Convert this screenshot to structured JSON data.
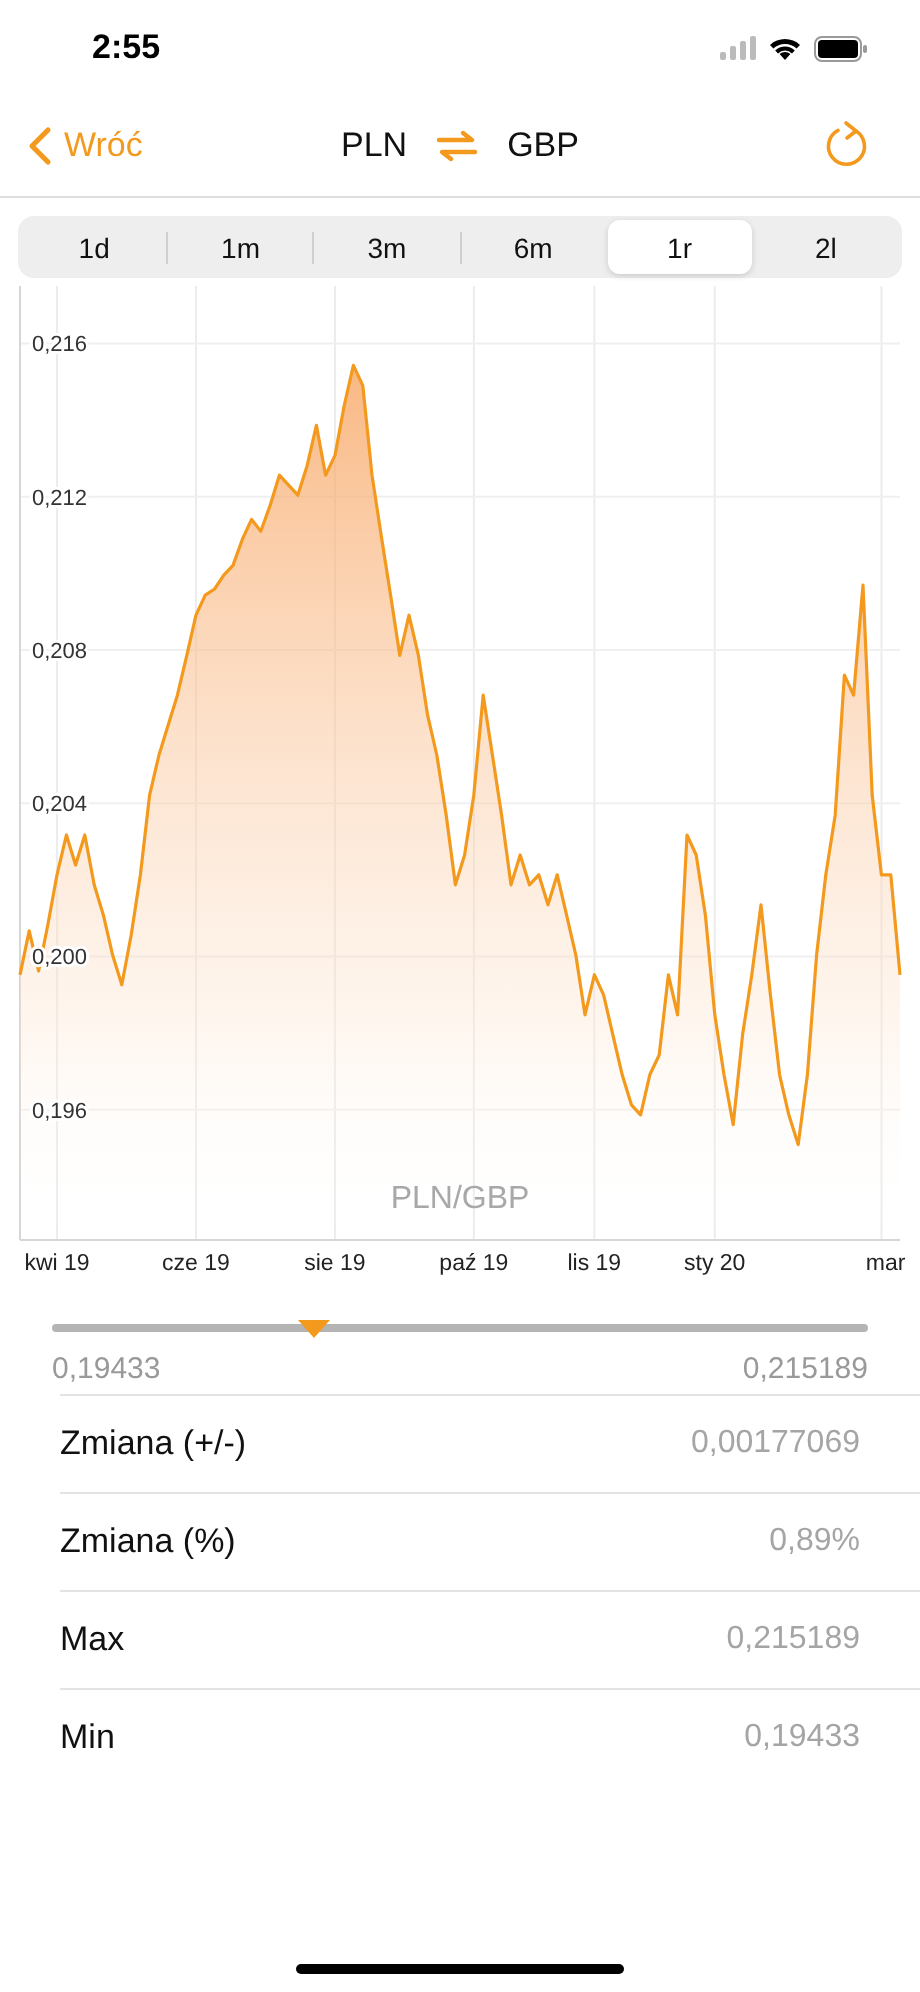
{
  "status_bar": {
    "time": "2:55"
  },
  "nav": {
    "back": "Wróć",
    "from": "PLN",
    "to": "GBP"
  },
  "tabs": [
    {
      "label": "1d",
      "selected": false
    },
    {
      "label": "1m",
      "selected": false
    },
    {
      "label": "3m",
      "selected": false
    },
    {
      "label": "6m",
      "selected": false
    },
    {
      "label": "1r",
      "selected": true
    },
    {
      "label": "2l",
      "selected": false
    }
  ],
  "chart": {
    "chart_data": {
      "type": "area",
      "title": "PLN/GBP",
      "categories": [
        null,
        null,
        null,
        null,
        "kwi 19",
        null,
        null,
        null,
        null,
        null,
        null,
        null,
        null,
        null,
        null,
        null,
        null,
        null,
        null,
        "cze 19",
        null,
        null,
        null,
        null,
        null,
        null,
        null,
        null,
        null,
        null,
        null,
        null,
        null,
        null,
        "sie 19",
        null,
        null,
        null,
        null,
        null,
        null,
        null,
        null,
        null,
        null,
        null,
        null,
        null,
        null,
        "paź 19",
        null,
        null,
        null,
        null,
        null,
        null,
        null,
        null,
        null,
        null,
        null,
        null,
        "lis 19",
        null,
        null,
        null,
        null,
        null,
        null,
        null,
        null,
        null,
        null,
        null,
        null,
        "sty 20",
        null,
        null,
        null,
        null,
        null,
        null,
        null,
        null,
        null,
        null,
        null,
        null,
        null,
        null,
        null,
        null,
        null,
        "mar",
        null,
        null
      ],
      "series": [
        {
          "color": "#f39a1e",
          "values": [
            0.19952,
            0.20067,
            0.19962,
            0.20082,
            0.20213,
            0.20317,
            0.20239,
            0.20317,
            0.20187,
            0.20108,
            0.20004,
            0.19926,
            0.20056,
            0.20213,
            0.20421,
            0.20526,
            0.20604,
            0.20682,
            0.20786,
            0.20891,
            0.20943,
            0.20959,
            0.20995,
            0.21021,
            0.21089,
            0.21141,
            0.2111,
            0.21178,
            0.21256,
            0.2123,
            0.21204,
            0.21282,
            0.21386,
            0.21256,
            0.21308,
            0.21438,
            0.21543,
            0.2149,
            0.21256,
            0.21099,
            0.20943,
            0.20786,
            0.20891,
            0.20786,
            0.2063,
            0.20526,
            0.20369,
            0.20187,
            0.20265,
            0.20421,
            0.20682,
            0.20526,
            0.20369,
            0.20187,
            0.20265,
            0.20187,
            0.20213,
            0.20135,
            0.20213,
            0.20108,
            0.20004,
            0.19848,
            0.19952,
            0.199,
            0.19796,
            0.19691,
            0.19613,
            0.19587,
            0.19691,
            0.19743,
            0.19952,
            0.19848,
            0.20317,
            0.20265,
            0.20108,
            0.19848,
            0.19691,
            0.19561,
            0.19796,
            0.19952,
            0.20135,
            0.199,
            0.19691,
            0.19587,
            0.19509,
            0.19691,
            0.20004,
            0.20213,
            0.20369,
            0.20734,
            0.20682,
            0.20969,
            0.20421,
            0.20213,
            0.20213,
            0.19952
          ]
        }
      ],
      "ylim": [
        0.1926,
        0.2175
      ],
      "grid": true,
      "yticks": [
        {
          "value": 0.196,
          "label": "0,196"
        },
        {
          "value": 0.2,
          "label": "0,200"
        },
        {
          "value": 0.204,
          "label": "0,204"
        },
        {
          "value": 0.208,
          "label": "0,208"
        },
        {
          "value": 0.212,
          "label": "0,212"
        },
        {
          "value": 0.216,
          "label": "0,216"
        }
      ]
    }
  },
  "range": {
    "level": 0.32,
    "min": "0,19433",
    "max": "0,215189"
  },
  "stats": [
    {
      "label": "Zmiana (+/-)",
      "value": "0,00177069"
    },
    {
      "label": "Zmiana (%)",
      "value": "0,89%"
    },
    {
      "label": "Max",
      "value": "0,215189"
    },
    {
      "label": "Min",
      "value": "0,19433"
    }
  ]
}
